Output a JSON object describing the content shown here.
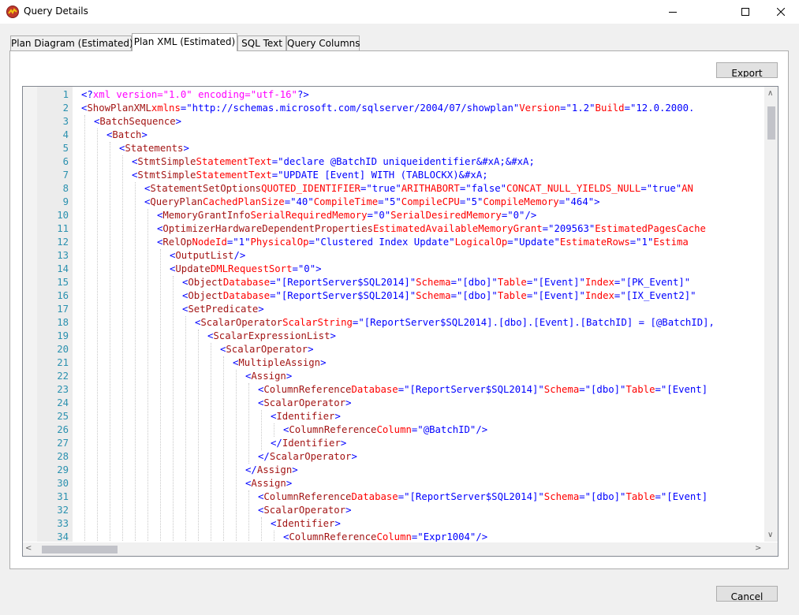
{
  "window": {
    "title": "Query Details"
  },
  "tabs": [
    {
      "label": "Plan Diagram (Estimated)",
      "active": false
    },
    {
      "label": "Plan XML (Estimated)",
      "active": true
    },
    {
      "label": "SQL Text",
      "active": false
    },
    {
      "label": "Query Columns",
      "active": false
    }
  ],
  "buttons": {
    "export_label": "Export",
    "cancel_label": "Cancel"
  },
  "colors": {
    "tag": "#0000ff",
    "element_name": "#a31515",
    "attribute": "#ff0000",
    "value": "#0000ff",
    "processing_instruction": "#ff00ff",
    "line_number": "#2b91af"
  },
  "editor": {
    "lines": [
      {
        "n": "1",
        "indent": 0,
        "tokens": [
          [
            "tag",
            "<?"
          ],
          [
            "pi",
            "xml version=\"1.0\" encoding=\"utf-16\""
          ],
          [
            "tag",
            "?>"
          ]
        ]
      },
      {
        "n": "2",
        "indent": 0,
        "tokens": [
          [
            "tag",
            "<"
          ],
          [
            "nm",
            "ShowPlanXML"
          ],
          [
            "txt",
            " "
          ],
          [
            "attr",
            "xmlns"
          ],
          [
            "tag",
            "="
          ],
          [
            "val",
            "\"http://schemas.microsoft.com/sqlserver/2004/07/showplan\""
          ],
          [
            "txt",
            " "
          ],
          [
            "attr",
            "Version"
          ],
          [
            "tag",
            "="
          ],
          [
            "val",
            "\"1.2\""
          ],
          [
            "txt",
            " "
          ],
          [
            "attr",
            "Build"
          ],
          [
            "tag",
            "="
          ],
          [
            "val",
            "\"12.0.2000."
          ]
        ]
      },
      {
        "n": "3",
        "indent": 1,
        "tokens": [
          [
            "tag",
            "<"
          ],
          [
            "nm",
            "BatchSequence"
          ],
          [
            "tag",
            ">"
          ]
        ]
      },
      {
        "n": "4",
        "indent": 2,
        "tokens": [
          [
            "tag",
            "<"
          ],
          [
            "nm",
            "Batch"
          ],
          [
            "tag",
            ">"
          ]
        ]
      },
      {
        "n": "5",
        "indent": 3,
        "tokens": [
          [
            "tag",
            "<"
          ],
          [
            "nm",
            "Statements"
          ],
          [
            "tag",
            ">"
          ]
        ]
      },
      {
        "n": "6",
        "indent": 4,
        "tokens": [
          [
            "tag",
            "<"
          ],
          [
            "nm",
            "StmtSimple"
          ],
          [
            "txt",
            " "
          ],
          [
            "attr",
            "StatementText"
          ],
          [
            "tag",
            "="
          ],
          [
            "val",
            "\"declare @BatchID uniqueidentifier&#xA;&#xA;"
          ]
        ]
      },
      {
        "n": "7",
        "indent": 4,
        "tokens": [
          [
            "tag",
            "<"
          ],
          [
            "nm",
            "StmtSimple"
          ],
          [
            "txt",
            " "
          ],
          [
            "attr",
            "StatementText"
          ],
          [
            "tag",
            "="
          ],
          [
            "val",
            "\"UPDATE [Event] WITH (TABLOCKX)&#xA;"
          ]
        ]
      },
      {
        "n": "8",
        "indent": 5,
        "tokens": [
          [
            "tag",
            "<"
          ],
          [
            "nm",
            "StatementSetOptions"
          ],
          [
            "txt",
            " "
          ],
          [
            "attr",
            "QUOTED_IDENTIFIER"
          ],
          [
            "tag",
            "="
          ],
          [
            "val",
            "\"true\""
          ],
          [
            "txt",
            " "
          ],
          [
            "attr",
            "ARITHABORT"
          ],
          [
            "tag",
            "="
          ],
          [
            "val",
            "\"false\""
          ],
          [
            "txt",
            " "
          ],
          [
            "attr",
            "CONCAT_NULL_YIELDS_NULL"
          ],
          [
            "tag",
            "="
          ],
          [
            "val",
            "\"true\""
          ],
          [
            "txt",
            " "
          ],
          [
            "attr",
            "AN"
          ]
        ]
      },
      {
        "n": "9",
        "indent": 5,
        "tokens": [
          [
            "tag",
            "<"
          ],
          [
            "nm",
            "QueryPlan"
          ],
          [
            "txt",
            " "
          ],
          [
            "attr",
            "CachedPlanSize"
          ],
          [
            "tag",
            "="
          ],
          [
            "val",
            "\"40\""
          ],
          [
            "txt",
            " "
          ],
          [
            "attr",
            "CompileTime"
          ],
          [
            "tag",
            "="
          ],
          [
            "val",
            "\"5\""
          ],
          [
            "txt",
            " "
          ],
          [
            "attr",
            "CompileCPU"
          ],
          [
            "tag",
            "="
          ],
          [
            "val",
            "\"5\""
          ],
          [
            "txt",
            " "
          ],
          [
            "attr",
            "CompileMemory"
          ],
          [
            "tag",
            "="
          ],
          [
            "val",
            "\"464\""
          ],
          [
            "tag",
            ">"
          ]
        ]
      },
      {
        "n": "10",
        "indent": 6,
        "tokens": [
          [
            "tag",
            "<"
          ],
          [
            "nm",
            "MemoryGrantInfo"
          ],
          [
            "txt",
            " "
          ],
          [
            "attr",
            "SerialRequiredMemory"
          ],
          [
            "tag",
            "="
          ],
          [
            "val",
            "\"0\""
          ],
          [
            "txt",
            " "
          ],
          [
            "attr",
            "SerialDesiredMemory"
          ],
          [
            "tag",
            "="
          ],
          [
            "val",
            "\"0\""
          ],
          [
            "txt",
            " "
          ],
          [
            "tag",
            "/>"
          ]
        ]
      },
      {
        "n": "11",
        "indent": 6,
        "tokens": [
          [
            "tag",
            "<"
          ],
          [
            "nm",
            "OptimizerHardwareDependentProperties"
          ],
          [
            "txt",
            " "
          ],
          [
            "attr",
            "EstimatedAvailableMemoryGrant"
          ],
          [
            "tag",
            "="
          ],
          [
            "val",
            "\"209563\""
          ],
          [
            "txt",
            " "
          ],
          [
            "attr",
            "EstimatedPagesCache"
          ]
        ]
      },
      {
        "n": "12",
        "indent": 6,
        "tokens": [
          [
            "tag",
            "<"
          ],
          [
            "nm",
            "RelOp"
          ],
          [
            "txt",
            " "
          ],
          [
            "attr",
            "NodeId"
          ],
          [
            "tag",
            "="
          ],
          [
            "val",
            "\"1\""
          ],
          [
            "txt",
            " "
          ],
          [
            "attr",
            "PhysicalOp"
          ],
          [
            "tag",
            "="
          ],
          [
            "val",
            "\"Clustered Index Update\""
          ],
          [
            "txt",
            " "
          ],
          [
            "attr",
            "LogicalOp"
          ],
          [
            "tag",
            "="
          ],
          [
            "val",
            "\"Update\""
          ],
          [
            "txt",
            " "
          ],
          [
            "attr",
            "EstimateRows"
          ],
          [
            "tag",
            "="
          ],
          [
            "val",
            "\"1\""
          ],
          [
            "txt",
            " "
          ],
          [
            "attr",
            "Estima"
          ]
        ]
      },
      {
        "n": "13",
        "indent": 7,
        "tokens": [
          [
            "tag",
            "<"
          ],
          [
            "nm",
            "OutputList"
          ],
          [
            "txt",
            " "
          ],
          [
            "tag",
            "/>"
          ]
        ]
      },
      {
        "n": "14",
        "indent": 7,
        "tokens": [
          [
            "tag",
            "<"
          ],
          [
            "nm",
            "Update"
          ],
          [
            "txt",
            " "
          ],
          [
            "attr",
            "DMLRequestSort"
          ],
          [
            "tag",
            "="
          ],
          [
            "val",
            "\"0\""
          ],
          [
            "tag",
            ">"
          ]
        ]
      },
      {
        "n": "15",
        "indent": 8,
        "tokens": [
          [
            "tag",
            "<"
          ],
          [
            "nm",
            "Object"
          ],
          [
            "txt",
            " "
          ],
          [
            "attr",
            "Database"
          ],
          [
            "tag",
            "="
          ],
          [
            "val",
            "\"[ReportServer$SQL2014]\""
          ],
          [
            "txt",
            " "
          ],
          [
            "attr",
            "Schema"
          ],
          [
            "tag",
            "="
          ],
          [
            "val",
            "\"[dbo]\""
          ],
          [
            "txt",
            " "
          ],
          [
            "attr",
            "Table"
          ],
          [
            "tag",
            "="
          ],
          [
            "val",
            "\"[Event]\""
          ],
          [
            "txt",
            " "
          ],
          [
            "attr",
            "Index"
          ],
          [
            "tag",
            "="
          ],
          [
            "val",
            "\"[PK_Event]\""
          ]
        ]
      },
      {
        "n": "16",
        "indent": 8,
        "tokens": [
          [
            "tag",
            "<"
          ],
          [
            "nm",
            "Object"
          ],
          [
            "txt",
            " "
          ],
          [
            "attr",
            "Database"
          ],
          [
            "tag",
            "="
          ],
          [
            "val",
            "\"[ReportServer$SQL2014]\""
          ],
          [
            "txt",
            " "
          ],
          [
            "attr",
            "Schema"
          ],
          [
            "tag",
            "="
          ],
          [
            "val",
            "\"[dbo]\""
          ],
          [
            "txt",
            " "
          ],
          [
            "attr",
            "Table"
          ],
          [
            "tag",
            "="
          ],
          [
            "val",
            "\"[Event]\""
          ],
          [
            "txt",
            " "
          ],
          [
            "attr",
            "Index"
          ],
          [
            "tag",
            "="
          ],
          [
            "val",
            "\"[IX_Event2]\""
          ]
        ]
      },
      {
        "n": "17",
        "indent": 8,
        "tokens": [
          [
            "tag",
            "<"
          ],
          [
            "nm",
            "SetPredicate"
          ],
          [
            "tag",
            ">"
          ]
        ]
      },
      {
        "n": "18",
        "indent": 9,
        "tokens": [
          [
            "tag",
            "<"
          ],
          [
            "nm",
            "ScalarOperator"
          ],
          [
            "txt",
            " "
          ],
          [
            "attr",
            "ScalarString"
          ],
          [
            "tag",
            "="
          ],
          [
            "val",
            "\"[ReportServer$SQL2014].[dbo].[Event].[BatchID] = [@BatchID],"
          ]
        ]
      },
      {
        "n": "19",
        "indent": 10,
        "tokens": [
          [
            "tag",
            "<"
          ],
          [
            "nm",
            "ScalarExpressionList"
          ],
          [
            "tag",
            ">"
          ]
        ]
      },
      {
        "n": "20",
        "indent": 11,
        "tokens": [
          [
            "tag",
            "<"
          ],
          [
            "nm",
            "ScalarOperator"
          ],
          [
            "tag",
            ">"
          ]
        ]
      },
      {
        "n": "21",
        "indent": 12,
        "tokens": [
          [
            "tag",
            "<"
          ],
          [
            "nm",
            "MultipleAssign"
          ],
          [
            "tag",
            ">"
          ]
        ]
      },
      {
        "n": "22",
        "indent": 13,
        "tokens": [
          [
            "tag",
            "<"
          ],
          [
            "nm",
            "Assign"
          ],
          [
            "tag",
            ">"
          ]
        ]
      },
      {
        "n": "23",
        "indent": 14,
        "tokens": [
          [
            "tag",
            "<"
          ],
          [
            "nm",
            "ColumnReference"
          ],
          [
            "txt",
            " "
          ],
          [
            "attr",
            "Database"
          ],
          [
            "tag",
            "="
          ],
          [
            "val",
            "\"[ReportServer$SQL2014]\""
          ],
          [
            "txt",
            " "
          ],
          [
            "attr",
            "Schema"
          ],
          [
            "tag",
            "="
          ],
          [
            "val",
            "\"[dbo]\""
          ],
          [
            "txt",
            " "
          ],
          [
            "attr",
            "Table"
          ],
          [
            "tag",
            "="
          ],
          [
            "val",
            "\"[Event]"
          ]
        ]
      },
      {
        "n": "24",
        "indent": 14,
        "tokens": [
          [
            "tag",
            "<"
          ],
          [
            "nm",
            "ScalarOperator"
          ],
          [
            "tag",
            ">"
          ]
        ]
      },
      {
        "n": "25",
        "indent": 15,
        "tokens": [
          [
            "tag",
            "<"
          ],
          [
            "nm",
            "Identifier"
          ],
          [
            "tag",
            ">"
          ]
        ]
      },
      {
        "n": "26",
        "indent": 16,
        "tokens": [
          [
            "tag",
            "<"
          ],
          [
            "nm",
            "ColumnReference"
          ],
          [
            "txt",
            " "
          ],
          [
            "attr",
            "Column"
          ],
          [
            "tag",
            "="
          ],
          [
            "val",
            "\"@BatchID\""
          ],
          [
            "txt",
            " "
          ],
          [
            "tag",
            "/>"
          ]
        ]
      },
      {
        "n": "27",
        "indent": 15,
        "tokens": [
          [
            "tag",
            "</"
          ],
          [
            "nm",
            "Identifier"
          ],
          [
            "tag",
            ">"
          ]
        ]
      },
      {
        "n": "28",
        "indent": 14,
        "tokens": [
          [
            "tag",
            "</"
          ],
          [
            "nm",
            "ScalarOperator"
          ],
          [
            "tag",
            ">"
          ]
        ]
      },
      {
        "n": "29",
        "indent": 13,
        "tokens": [
          [
            "tag",
            "</"
          ],
          [
            "nm",
            "Assign"
          ],
          [
            "tag",
            ">"
          ]
        ]
      },
      {
        "n": "30",
        "indent": 13,
        "tokens": [
          [
            "tag",
            "<"
          ],
          [
            "nm",
            "Assign"
          ],
          [
            "tag",
            ">"
          ]
        ]
      },
      {
        "n": "31",
        "indent": 14,
        "tokens": [
          [
            "tag",
            "<"
          ],
          [
            "nm",
            "ColumnReference"
          ],
          [
            "txt",
            " "
          ],
          [
            "attr",
            "Database"
          ],
          [
            "tag",
            "="
          ],
          [
            "val",
            "\"[ReportServer$SQL2014]\""
          ],
          [
            "txt",
            " "
          ],
          [
            "attr",
            "Schema"
          ],
          [
            "tag",
            "="
          ],
          [
            "val",
            "\"[dbo]\""
          ],
          [
            "txt",
            " "
          ],
          [
            "attr",
            "Table"
          ],
          [
            "tag",
            "="
          ],
          [
            "val",
            "\"[Event]"
          ]
        ]
      },
      {
        "n": "32",
        "indent": 14,
        "tokens": [
          [
            "tag",
            "<"
          ],
          [
            "nm",
            "ScalarOperator"
          ],
          [
            "tag",
            ">"
          ]
        ]
      },
      {
        "n": "33",
        "indent": 15,
        "tokens": [
          [
            "tag",
            "<"
          ],
          [
            "nm",
            "Identifier"
          ],
          [
            "tag",
            ">"
          ]
        ]
      },
      {
        "n": "34",
        "indent": 16,
        "tokens": [
          [
            "tag",
            "<"
          ],
          [
            "nm",
            "ColumnReference"
          ],
          [
            "txt",
            " "
          ],
          [
            "attr",
            "Column"
          ],
          [
            "tag",
            "="
          ],
          [
            "val",
            "\"Expr1004\""
          ],
          [
            "txt",
            " "
          ],
          [
            "tag",
            "/>"
          ]
        ]
      }
    ]
  }
}
